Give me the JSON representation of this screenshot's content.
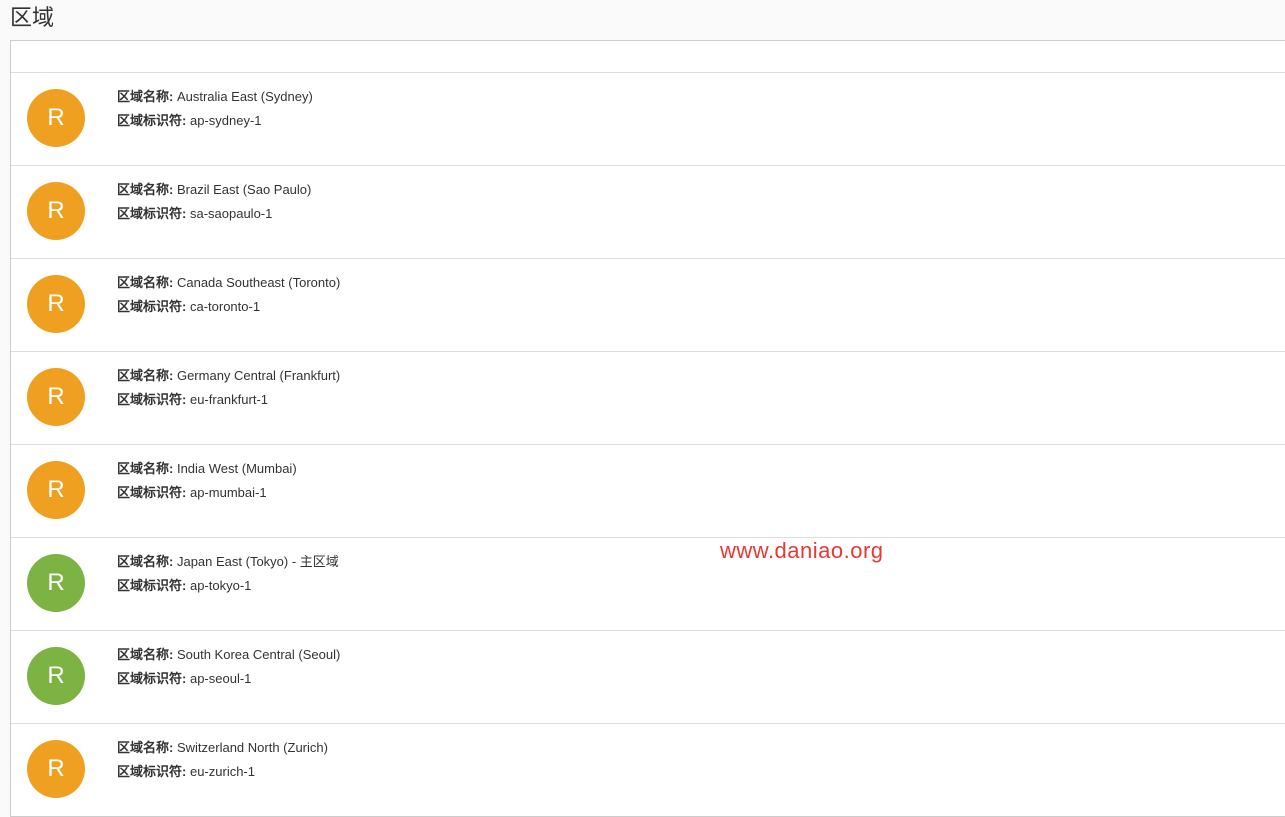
{
  "page": {
    "title": "区域"
  },
  "labels": {
    "region_name": "区域名称:",
    "region_id": "区域标识符:"
  },
  "avatar_letter": "R",
  "watermark": "www.daniao.org",
  "regions": [
    {
      "name": "Australia East (Sydney)",
      "id": "ap-sydney-1",
      "color": "orange"
    },
    {
      "name": "Brazil East (Sao Paulo)",
      "id": "sa-saopaulo-1",
      "color": "orange"
    },
    {
      "name": "Canada Southeast (Toronto)",
      "id": "ca-toronto-1",
      "color": "orange"
    },
    {
      "name": "Germany Central (Frankfurt)",
      "id": "eu-frankfurt-1",
      "color": "orange"
    },
    {
      "name": "India West (Mumbai)",
      "id": "ap-mumbai-1",
      "color": "orange"
    },
    {
      "name": " Japan East (Tokyo) - 主区域",
      "id": "ap-tokyo-1",
      "color": "green"
    },
    {
      "name": "South Korea Central (Seoul)",
      "id": "ap-seoul-1",
      "color": "green"
    },
    {
      "name": "Switzerland North (Zurich)",
      "id": "eu-zurich-1",
      "color": "orange"
    }
  ]
}
